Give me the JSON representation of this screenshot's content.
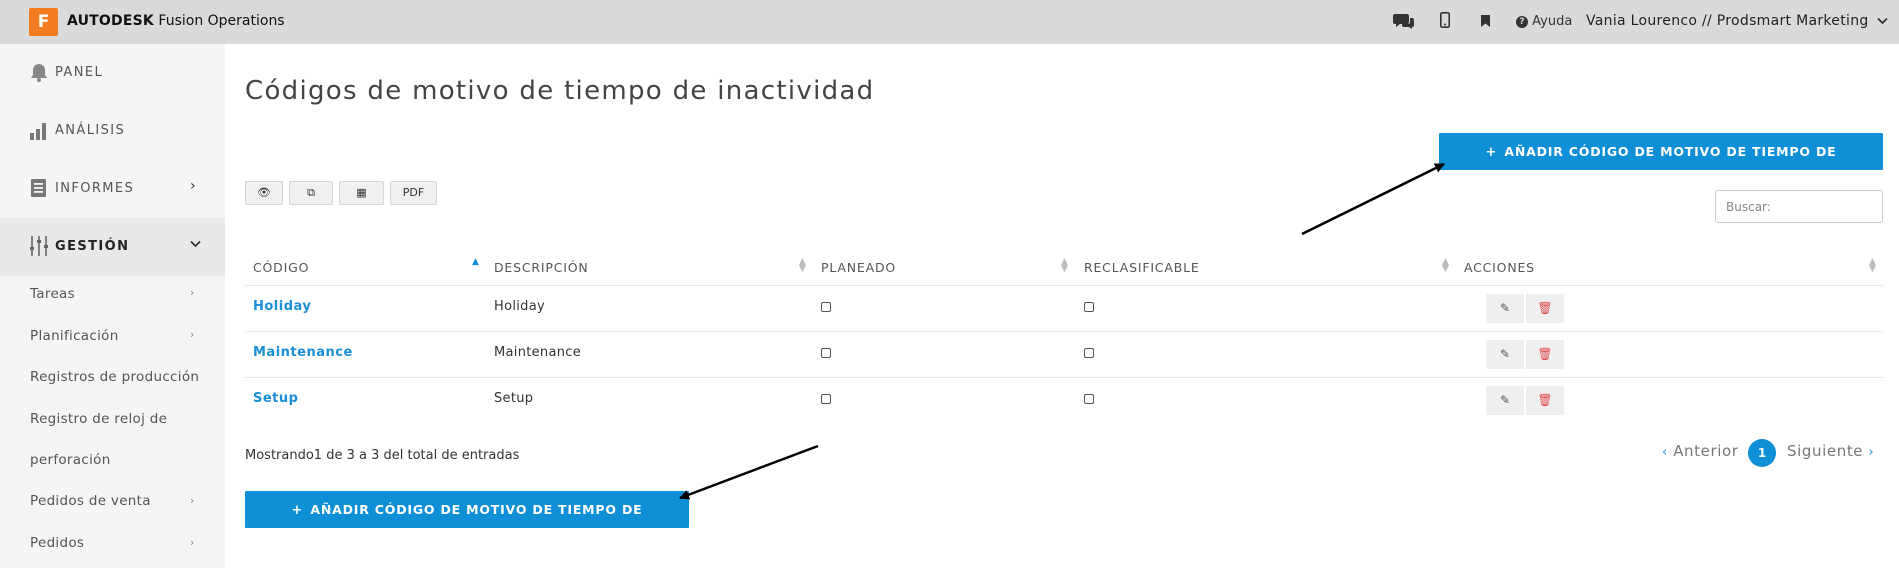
{
  "app": {
    "logo_letter": "F",
    "brand_bold": "AUTODESK",
    "brand_rest": "Fusion Operations",
    "logo_color": "#f47c20"
  },
  "topbar": {
    "help_label": "Ayuda",
    "user_label": "Vania Lourenco // Prodsmart Marketing",
    "icons": [
      "chat-icon",
      "mobile-icon",
      "bookmark-icon",
      "help-icon",
      "chevron-down-icon"
    ]
  },
  "sidebar": {
    "main": [
      {
        "label": "PANEL",
        "icon": "bell-icon"
      },
      {
        "label": "ANÁLISIS",
        "icon": "bar-chart-icon"
      },
      {
        "label": "INFORMES",
        "icon": "document-icon",
        "chevron": "›"
      },
      {
        "label": "GESTIÓN",
        "icon": "sliders-icon",
        "chevron": "⌄"
      }
    ],
    "sub": [
      {
        "label": "Tareas",
        "chevron": "›"
      },
      {
        "label": "Planificación",
        "chevron": "›"
      },
      {
        "label": "Registros de producción"
      },
      {
        "label": "Registro de reloj de"
      },
      {
        "label": "perforación"
      },
      {
        "label": "Pedidos de venta",
        "chevron": "›"
      },
      {
        "label": "Pedidos",
        "chevron": "›"
      }
    ]
  },
  "main": {
    "title": "Códigos de motivo de tiempo de inactividad",
    "add_button": "AÑADIR CÓDIGO DE MOTIVO DE TIEMPO DE INACTIVIDAD",
    "add_plus": "+",
    "tools": [
      "👁",
      "⧉",
      "▦",
      "PDF"
    ],
    "search_placeholder": "Buscar:",
    "columns": [
      "CÓDIGO",
      "DESCRIPCIÓN",
      "PLANEADO",
      "RECLASIFICABLE",
      "ACCIONES"
    ],
    "rows": [
      {
        "code": "Holiday",
        "description": "Holiday"
      },
      {
        "code": "Maintenance",
        "description": "Maintenance"
      },
      {
        "code": "Setup",
        "description": "Setup"
      }
    ],
    "info": "Mostrando1 de 3 a 3 del total de entradas",
    "pager": {
      "prev": "Anterior",
      "page": "1",
      "next": "Siguiente",
      "prev_chev": "‹",
      "next_chev": "›"
    },
    "accent_color": "#0f8fd6"
  }
}
